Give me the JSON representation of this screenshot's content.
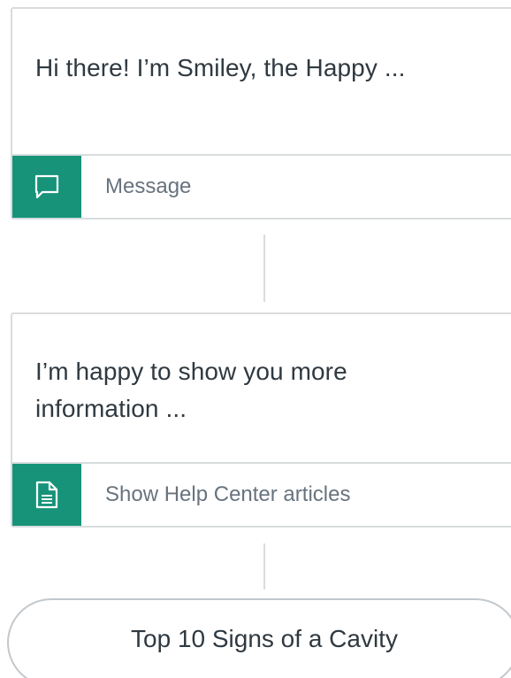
{
  "flow": {
    "steps": [
      {
        "text": "Hi there! I’m Smiley, the Happy ...",
        "action": {
          "icon": "speech-bubble-icon",
          "label": "Message"
        }
      },
      {
        "text": "I’m happy to show you more information ...",
        "action": {
          "icon": "document-icon",
          "label": "Show Help Center articles"
        }
      }
    ],
    "article": {
      "label": "Top 10 Signs of a Cavity"
    }
  },
  "colors": {
    "accent": "#17937a",
    "border": "#d8dcde",
    "text_primary": "#2f3941",
    "text_secondary": "#68737d"
  }
}
